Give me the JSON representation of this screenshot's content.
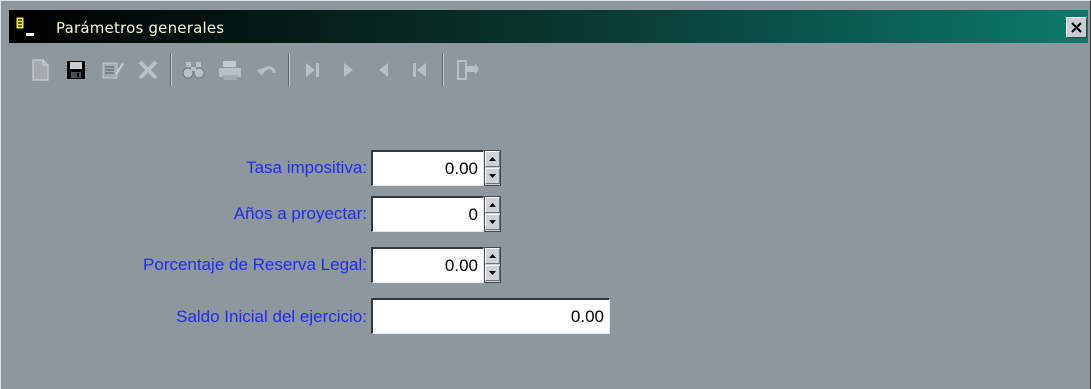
{
  "window": {
    "title": "Parámetros generales",
    "close_label": "X"
  },
  "toolbar": {
    "buttons": [
      "new-document-icon",
      "save-icon",
      "edit-icon",
      "delete-icon",
      "find-icon",
      "print-icon",
      "undo-icon",
      "last-record-icon",
      "next-record-icon",
      "previous-record-icon",
      "first-record-icon",
      "exit-icon"
    ]
  },
  "form": {
    "tasa_label": "Tasa impositiva:",
    "tasa_value": "0.00",
    "anios_label": "Años a proyectar:",
    "anios_value": "0",
    "reserva_label": "Porcentaje de Reserva Legal:",
    "reserva_value": "0.00",
    "saldo_label": "Saldo Inicial del ejercicio:",
    "saldo_value": "0.00"
  },
  "colors": {
    "label": "#1d2cf0",
    "background": "#8f979e",
    "titlebar_start": "#000000",
    "titlebar_end": "#0b7a6c"
  }
}
